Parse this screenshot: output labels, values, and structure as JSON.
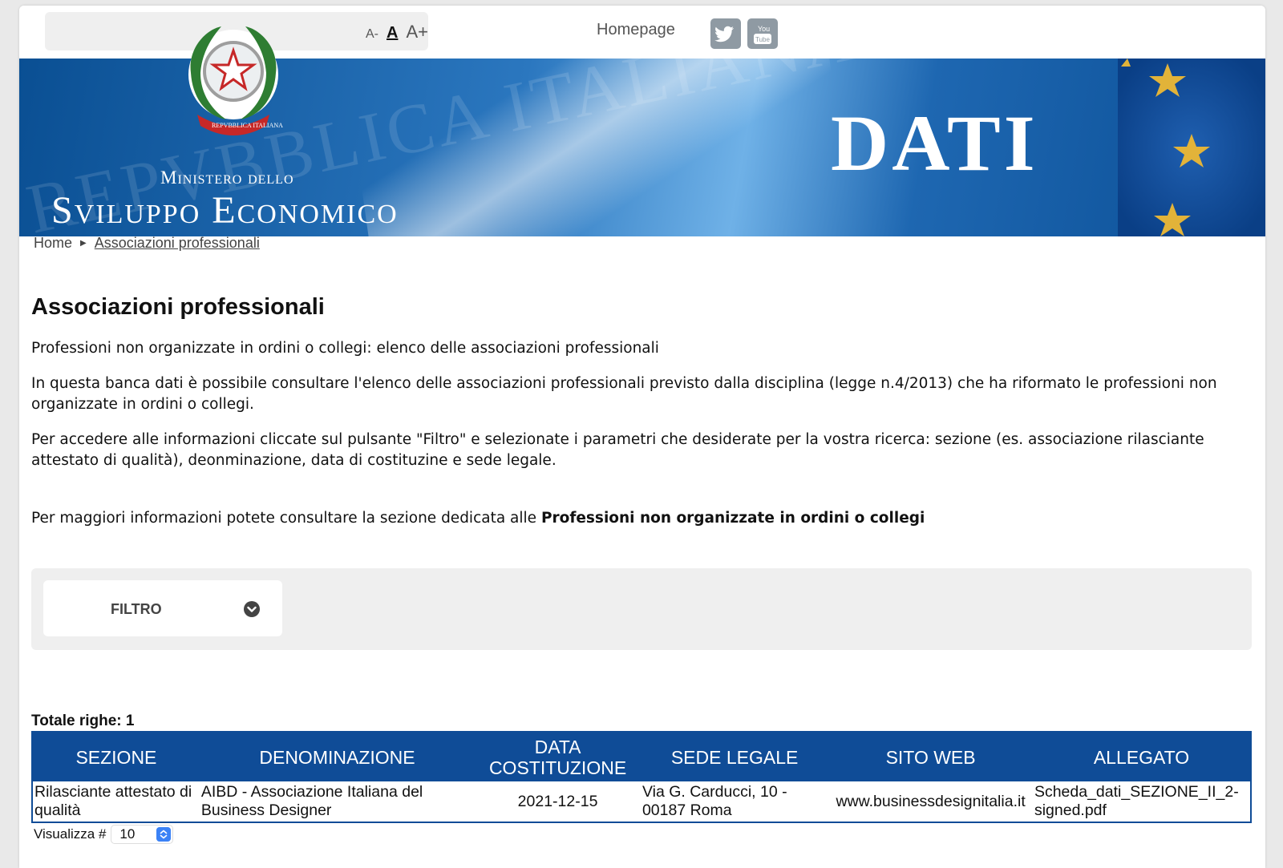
{
  "toolbar": {
    "font_small": "A-",
    "font_normal": "A",
    "font_big": "A+",
    "homepage": "Homepage",
    "social": [
      {
        "name": "twitter-icon"
      },
      {
        "name": "youtube-icon"
      }
    ]
  },
  "banner": {
    "watermark": "REPVBBLICA ITALIANA",
    "ministry_line1": "Ministero dello",
    "ministry_line2": "Sviluppo Economico",
    "section_title": "DATI",
    "emblem_ribbon": "REPVBBLICA ITALIANA"
  },
  "breadcrumb": {
    "home": "Home",
    "current": "Associazioni professionali"
  },
  "main": {
    "title": "Associazioni professionali",
    "subtitle": "Professioni non organizzate in ordini o collegi: elenco delle associazioni professionali",
    "intro": "In questa banca dati è possibile consultare l'elenco delle associazioni professionali previsto dalla disciplina (legge n.4/2013) che ha riformato le professioni non organizzate in ordini o collegi.",
    "instructions": "Per accedere alle informazioni cliccate sul pulsante \"Filtro\" e selezionate i parametri che desiderate per la vostra ricerca: sezione (es. associazione rilasciante attestato di qualità), deonminazione, data di costituzine e sede legale.",
    "more_info_prefix": "Per maggiori informazioni potete consultare la sezione dedicata alle ",
    "more_info_link": "Professioni non organizzate in ordini o collegi"
  },
  "filter": {
    "label": "FILTRO"
  },
  "results": {
    "total_label": "Totale righe: 1",
    "columns": [
      "SEZIONE",
      "DENOMINAZIONE",
      "DATA COSTITUZIONE",
      "SEDE LEGALE",
      "SITO WEB",
      "ALLEGATO"
    ],
    "rows": [
      {
        "sezione": "Rilasciante attestato di qualità",
        "denominazione": "AIBD - Associazione Italiana del Business Designer",
        "data": "2021-12-15",
        "sede": "Via G. Carducci, 10 - 00187 Roma",
        "sito": "www.businessdesignitalia.it",
        "allegato": "Scheda_dati_SEZIONE_II_2-signed.pdf"
      }
    ],
    "page_size_label": "Visualizza #",
    "page_size_value": "10"
  },
  "colors": {
    "header_blue": "#0f4c97",
    "banner_blue": "#0a4f93"
  }
}
